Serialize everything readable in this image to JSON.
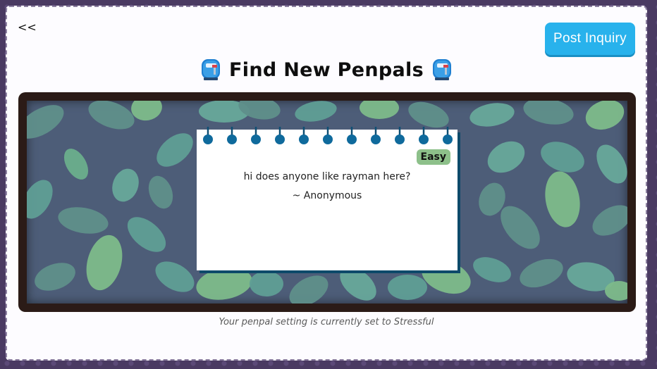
{
  "nav": {
    "back_label": "<<"
  },
  "header": {
    "post_button_label": "Post Inquiry",
    "title": "Find New Penpals",
    "title_icon": "mailbox-icon"
  },
  "board": {
    "note": {
      "difficulty": "Easy",
      "message": "hi does anyone like rayman here?",
      "author": "~ Anonymous"
    }
  },
  "footer": {
    "setting_text": "Your penpal setting is currently set to Stressful"
  },
  "colors": {
    "accent": "#28b2ec",
    "difficulty_badge": "#8dc08a",
    "board_frame": "#2b1b17",
    "board_bg": "#4d5d78"
  }
}
